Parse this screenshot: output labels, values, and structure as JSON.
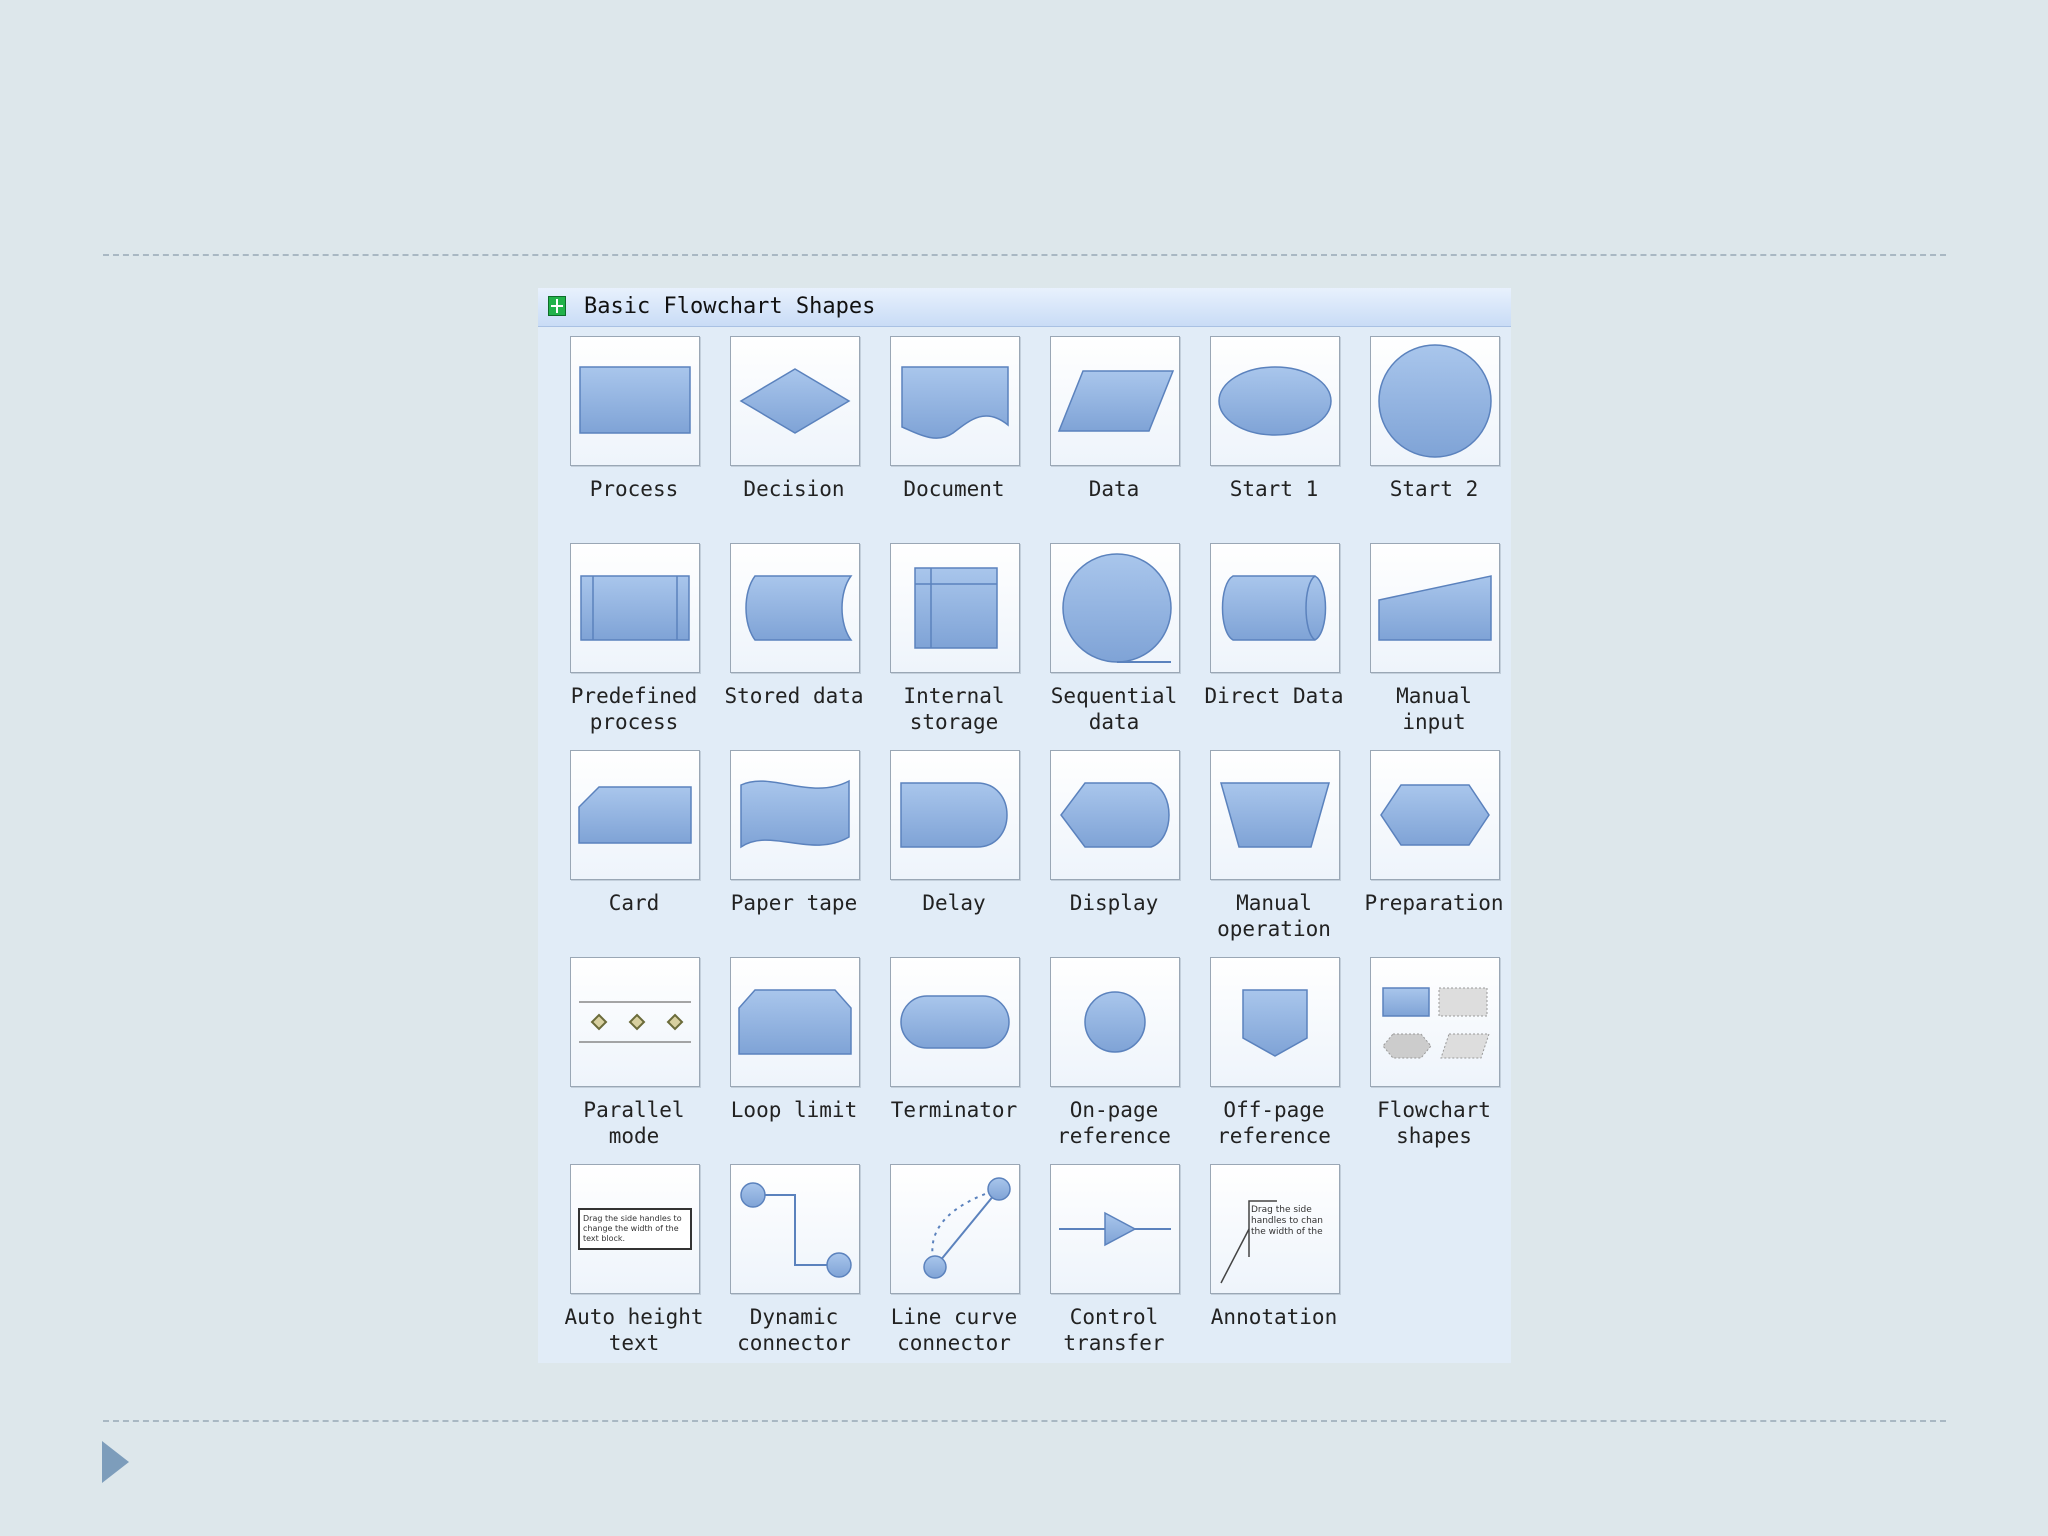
{
  "panel": {
    "title": "Basic Flowchart Shapes",
    "icon": "shape-library-icon"
  },
  "colors": {
    "background": "#dde7eb",
    "panel": "#e1ecf7",
    "shape_fill": "#8fb1e0",
    "shape_stroke": "#5b82bd",
    "arrow": "#7d9dbb"
  },
  "shapes": [
    {
      "label": "Process",
      "icon": "process-icon"
    },
    {
      "label": "Decision",
      "icon": "decision-icon"
    },
    {
      "label": "Document",
      "icon": "document-icon"
    },
    {
      "label": "Data",
      "icon": "data-icon"
    },
    {
      "label": "Start 1",
      "icon": "start-1-icon"
    },
    {
      "label": "Start 2",
      "icon": "start-2-icon"
    },
    {
      "label": "Predefined\nprocess",
      "icon": "predefined-process-icon"
    },
    {
      "label": "Stored data",
      "icon": "stored-data-icon"
    },
    {
      "label": "Internal\nstorage",
      "icon": "internal-storage-icon"
    },
    {
      "label": "Sequential\ndata",
      "icon": "sequential-data-icon"
    },
    {
      "label": "Direct Data",
      "icon": "direct-data-icon"
    },
    {
      "label": "Manual\ninput",
      "icon": "manual-input-icon"
    },
    {
      "label": "Card",
      "icon": "card-icon"
    },
    {
      "label": "Paper tape",
      "icon": "paper-tape-icon"
    },
    {
      "label": "Delay",
      "icon": "delay-icon"
    },
    {
      "label": "Display",
      "icon": "display-icon"
    },
    {
      "label": "Manual\noperation",
      "icon": "manual-operation-icon"
    },
    {
      "label": "Preparation",
      "icon": "preparation-icon"
    },
    {
      "label": "Parallel\nmode",
      "icon": "parallel-mode-icon"
    },
    {
      "label": "Loop limit",
      "icon": "loop-limit-icon"
    },
    {
      "label": "Terminator",
      "icon": "terminator-icon"
    },
    {
      "label": "On-page\nreference",
      "icon": "on-page-reference-icon"
    },
    {
      "label": "Off-page\nreference",
      "icon": "off-page-reference-icon"
    },
    {
      "label": "Flowchart\nshapes",
      "icon": "flowchart-shapes-icon"
    },
    {
      "label": "Auto height\ntext",
      "icon": "auto-height-text-icon"
    },
    {
      "label": "Dynamic\nconnector",
      "icon": "dynamic-connector-icon"
    },
    {
      "label": "Line curve\nconnector",
      "icon": "line-curve-connector-icon"
    },
    {
      "label": "Control\ntransfer",
      "icon": "control-transfer-icon"
    },
    {
      "label": "Annotation",
      "icon": "annotation-icon"
    }
  ]
}
